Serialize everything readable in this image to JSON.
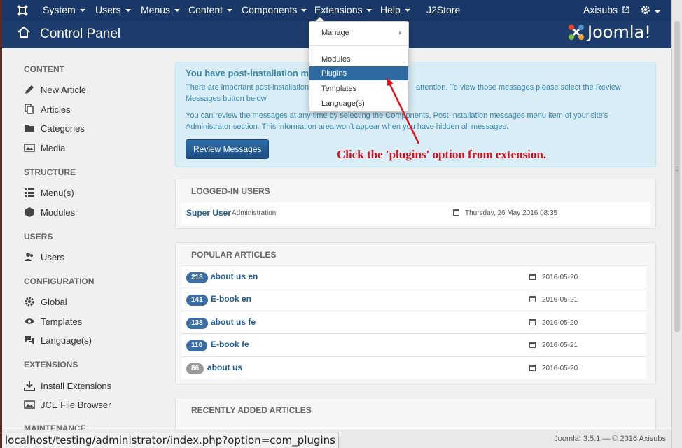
{
  "nav": {
    "items": [
      {
        "label": "System"
      },
      {
        "label": "Users"
      },
      {
        "label": "Menus"
      },
      {
        "label": "Content"
      },
      {
        "label": "Components"
      },
      {
        "label": "Extensions"
      },
      {
        "label": "Help"
      },
      {
        "label": "J2Store"
      }
    ],
    "user": "Axisubs"
  },
  "header": {
    "title": "Control Panel",
    "logo": "Joomla!"
  },
  "sidebar": {
    "sections": [
      {
        "title": "CONTENT",
        "items": [
          "New Article",
          "Articles",
          "Categories",
          "Media"
        ]
      },
      {
        "title": "STRUCTURE",
        "items": [
          "Menu(s)",
          "Modules"
        ]
      },
      {
        "title": "USERS",
        "items": [
          "Users"
        ]
      },
      {
        "title": "CONFIGURATION",
        "items": [
          "Global",
          "Templates",
          "Language(s)"
        ]
      },
      {
        "title": "EXTENSIONS",
        "items": [
          "Install Extensions",
          "JCE File Browser"
        ]
      },
      {
        "title": "MAINTENANCE"
      }
    ]
  },
  "alert": {
    "title": "You have post-installation me",
    "p1_a": "There are important post-installation",
    "p1_b": "attention. To view those messages please select the Review",
    "p1_c": "Messages button below.",
    "p2_a": "You can review the messages at any time by selecting the Components, Post-installation messages menu item of your site's",
    "p2_b": "Administrator section. This information area won't appear when you have hidden all messages.",
    "button": "Review Messages"
  },
  "logged_in": {
    "title": "LOGGED-IN USERS",
    "user": "Super User",
    "role": "Administration",
    "date": "Thursday, 26 May 2016 08:35"
  },
  "popular": {
    "title": "POPULAR ARTICLES",
    "rows": [
      {
        "hits": "218",
        "title": "about us en",
        "date": "2016-05-20"
      },
      {
        "hits": "141",
        "title": "E-book en",
        "date": "2016-05-21"
      },
      {
        "hits": "138",
        "title": "about us fe",
        "date": "2016-05-20"
      },
      {
        "hits": "110",
        "title": "E-book fe",
        "date": "2016-05-21"
      },
      {
        "hits": "86",
        "title": "about us",
        "date": "2016-05-20"
      }
    ]
  },
  "recent": {
    "title": "RECENTLY ADDED ARTICLES"
  },
  "extensions_menu": {
    "items": [
      "Manage",
      "Modules",
      "Plugins",
      "Templates",
      "Language(s)"
    ],
    "selected": "Plugins"
  },
  "annotation": "Click the 'plugins' option from extension.",
  "status_url": "localhost/testing/administrator/index.php?option=com_plugins",
  "footer": "Joomla! 3.5.1  —  © 2016 Axisubs"
}
